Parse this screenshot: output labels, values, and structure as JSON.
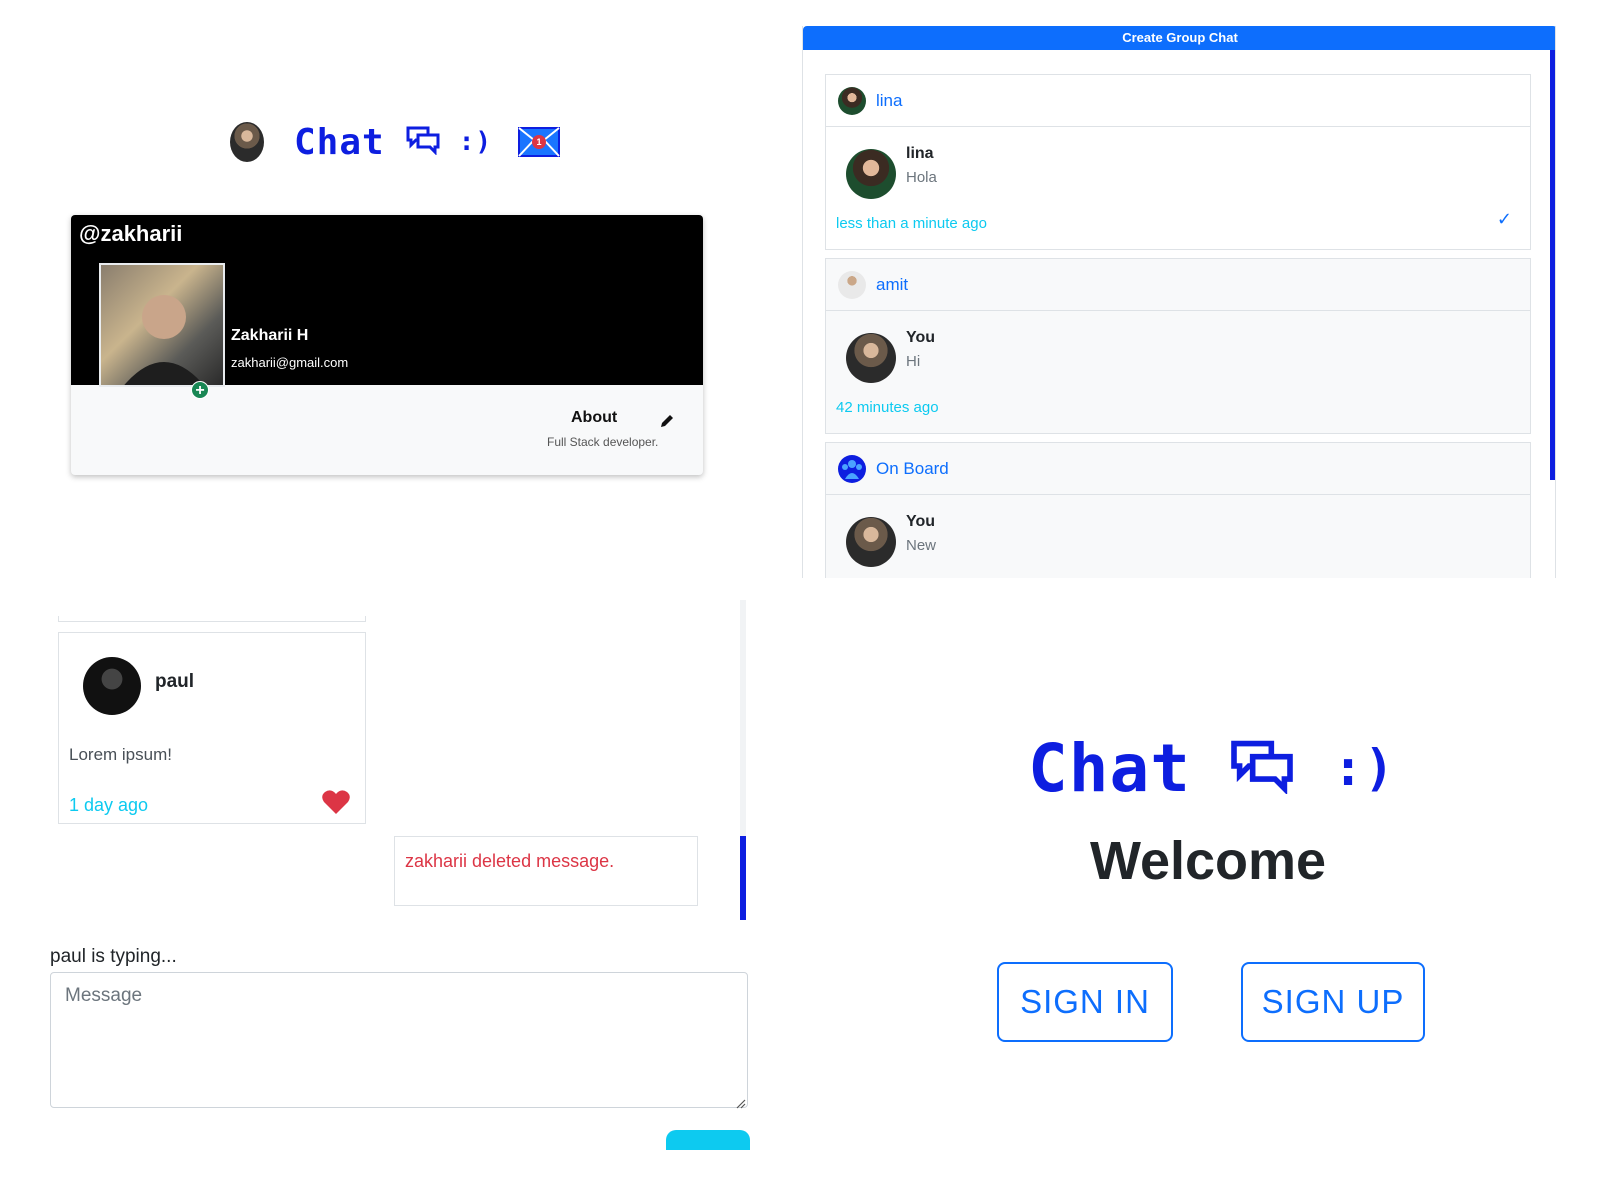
{
  "brand": {
    "name": "Chat",
    "smiley": ":)",
    "color": "#0d1ee0"
  },
  "header": {
    "mail_count": "1"
  },
  "profile": {
    "handle": "@zakharii",
    "name": "Zakharii H",
    "email": "zakharii@gmail.com",
    "about_title": "About",
    "about_text": "Full Stack developer."
  },
  "group_panel": {
    "create_button": "Create Group Chat",
    "chats": [
      {
        "title": "lina",
        "sender": "lina",
        "message": "Hola",
        "time": "less than a minute ago",
        "seen": true
      },
      {
        "title": "amit",
        "sender": "You",
        "message": "Hi",
        "time": "42 minutes ago"
      },
      {
        "title": "On Board",
        "sender": "You",
        "message": "New"
      }
    ]
  },
  "conversation": {
    "messages": [
      {
        "author": "paul",
        "text": "Lorem ipsum!",
        "time": "1 day ago",
        "liked": true
      },
      {
        "text": "zakharii deleted message."
      }
    ],
    "typing": "paul is typing...",
    "input_placeholder": "Message"
  },
  "welcome": {
    "title": "Welcome",
    "sign_in": "SIGN IN",
    "sign_up": "SIGN UP"
  },
  "colors": {
    "primary": "#0d6efd",
    "info": "#0dcaf0",
    "danger": "#dc3545",
    "success": "#198754"
  }
}
